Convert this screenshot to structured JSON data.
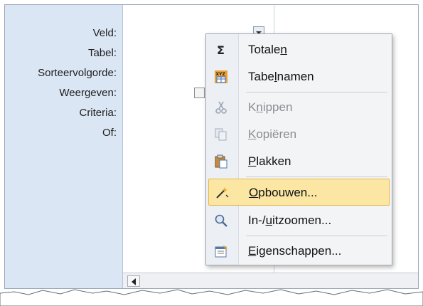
{
  "row_labels": [
    "Veld:",
    "Tabel:",
    "Sorteervolgorde:",
    "Weergeven:",
    "Criteria:",
    "Of:"
  ],
  "context_menu": {
    "items": [
      {
        "pre": "Totale",
        "accel": "n",
        "post": "",
        "icon": "sigma-icon",
        "enabled": true,
        "highlighted": false
      },
      {
        "pre": "Tabe",
        "accel": "l",
        "post": "namen",
        "icon": "table-names-icon",
        "enabled": true,
        "highlighted": false
      },
      {
        "pre": "K",
        "accel": "n",
        "post": "ippen",
        "icon": "scissors-icon",
        "enabled": false,
        "highlighted": false
      },
      {
        "pre": "",
        "accel": "K",
        "post": "opiëren",
        "icon": "copy-icon",
        "enabled": false,
        "highlighted": false
      },
      {
        "pre": "",
        "accel": "P",
        "post": "lakken",
        "icon": "paste-icon",
        "enabled": true,
        "highlighted": false
      },
      {
        "pre": "",
        "accel": "O",
        "post": "pbouwen...",
        "icon": "builder-wand-icon",
        "enabled": true,
        "highlighted": true
      },
      {
        "pre": "In-/",
        "accel": "u",
        "post": "itzoomen...",
        "icon": "magnifier-icon",
        "enabled": true,
        "highlighted": false
      },
      {
        "pre": "",
        "accel": "E",
        "post": "igenschappen...",
        "icon": "properties-icon",
        "enabled": true,
        "highlighted": false
      }
    ]
  },
  "colors": {
    "label_column": "#dbe6f5",
    "menu_background": "#f3f4f6",
    "highlight_fill": "#fbe7a3",
    "highlight_border": "#e3b949",
    "disabled_text": "#8a8d92"
  }
}
